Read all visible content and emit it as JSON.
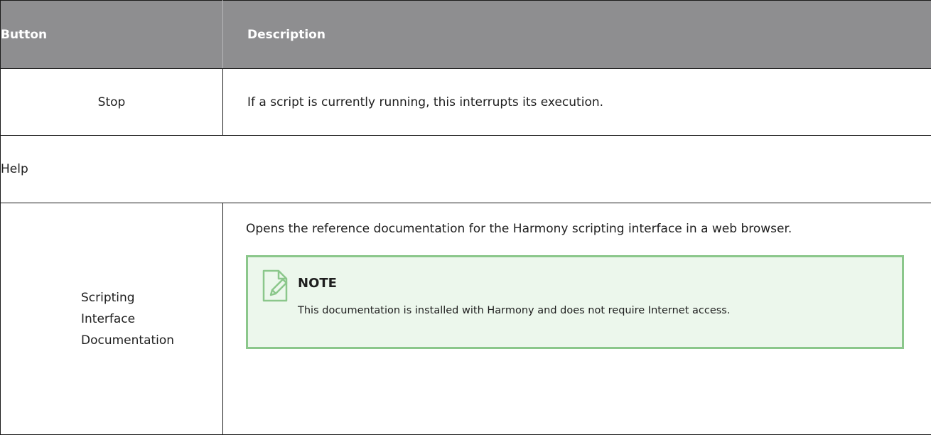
{
  "table": {
    "headers": {
      "button": "Button",
      "description": "Description"
    },
    "rows": [
      {
        "button": "Stop",
        "description": "If a script is currently running, this interrupts its execution."
      }
    ],
    "group": "Help",
    "help_rows": [
      {
        "button_lines": [
          "Scripting",
          "Interface",
          "Documentation"
        ],
        "description": "Opens the reference documentation for the Harmony scripting interface in a web browser.",
        "note": {
          "icon": "note-pencil-icon",
          "title": "NOTE",
          "body": "This documentation is installed with Harmony and does not require Internet access."
        }
      }
    ]
  },
  "colors": {
    "header_bg": "#8e8e90",
    "note_bg": "#ecf7ec",
    "note_border": "#8bc78b"
  }
}
